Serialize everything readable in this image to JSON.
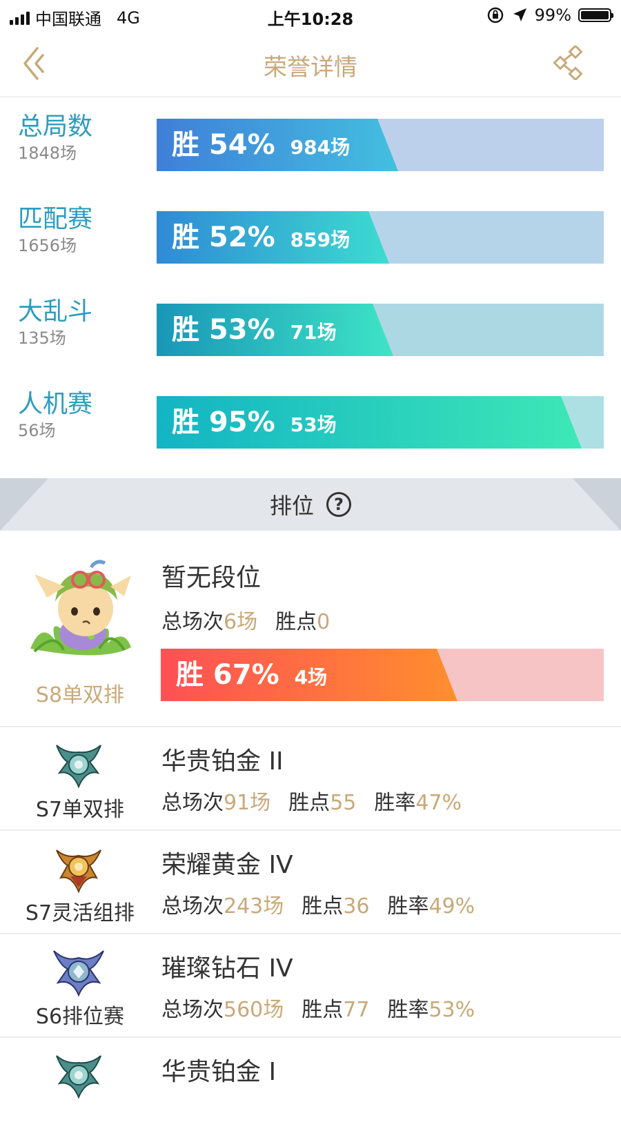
{
  "status_bar": {
    "carrier": "中国联通",
    "network": "4G",
    "time": "上午10:28",
    "battery": "99%",
    "battery_level": 0.99
  },
  "nav": {
    "title": "荣誉详情",
    "back_icon": "double-chevron-left-icon",
    "share_icon": "share-icon"
  },
  "colors": {
    "accent_gold": "#c8a978",
    "mode_name_blue": "#2b9cc0",
    "loss_red_light": "#f7c4c6"
  },
  "modes": [
    {
      "name": "总局数",
      "total": "1848场",
      "win_pct": "胜 54%",
      "win_count": "984场",
      "win_rate": 0.54,
      "bar_from": "#3f7fd8",
      "bar_to": "#43bfe0",
      "bar_bg": "#bcd0eb"
    },
    {
      "name": "匹配赛",
      "total": "1656场",
      "win_pct": "胜 52%",
      "win_count": "859场",
      "win_rate": 0.52,
      "bar_from": "#2f8ad6",
      "bar_to": "#3cdcd0",
      "bar_bg": "#b5d3e9"
    },
    {
      "name": "大乱斗",
      "total": "135场",
      "win_pct": "胜 53%",
      "win_count": "71场",
      "win_rate": 0.53,
      "bar_from": "#1996b8",
      "bar_to": "#3ee4c6",
      "bar_bg": "#acd8e3"
    },
    {
      "name": "人机赛",
      "total": "56场",
      "win_pct": "胜 95%",
      "win_count": "53场",
      "win_rate": 0.95,
      "bar_from": "#13b4c4",
      "bar_to": "#3ee8b6",
      "bar_bg": "#ace0e3"
    }
  ],
  "ranking": {
    "header": "排位",
    "help_icon": "question-circle-icon",
    "current": {
      "season": "S8单双排",
      "title": "暂无段位",
      "total_label": "总场次",
      "total_value": "6场",
      "points_label": "胜点",
      "points_value": "0",
      "win_pct": "胜 67%",
      "win_count": "4场",
      "win_rate": 0.67,
      "bar_from": "#ff5055",
      "bar_to": "#ff8e2e",
      "bar_bg": "#f7c4c6",
      "mascot_icon": "teemo-mascot-icon"
    },
    "history": [
      {
        "season": "S7单双排",
        "title": "华贵铂金 II",
        "total_label": "总场次",
        "total_value": "91场",
        "points_label": "胜点",
        "points_value": "55",
        "rate_label": "胜率",
        "rate_value": "47%",
        "medal_icon": "platinum-medal-icon"
      },
      {
        "season": "S7灵活组排",
        "title": "荣耀黄金 IV",
        "total_label": "总场次",
        "total_value": "243场",
        "points_label": "胜点",
        "points_value": "36",
        "rate_label": "胜率",
        "rate_value": "49%",
        "medal_icon": "gold-medal-icon"
      },
      {
        "season": "S6排位赛",
        "title": "璀璨钻石 IV",
        "total_label": "总场次",
        "total_value": "560场",
        "points_label": "胜点",
        "points_value": "77",
        "rate_label": "胜率",
        "rate_value": "53%",
        "medal_icon": "diamond-medal-icon"
      },
      {
        "season": "",
        "title": "华贵铂金 I",
        "medal_icon": "platinum-medal-icon"
      }
    ]
  }
}
